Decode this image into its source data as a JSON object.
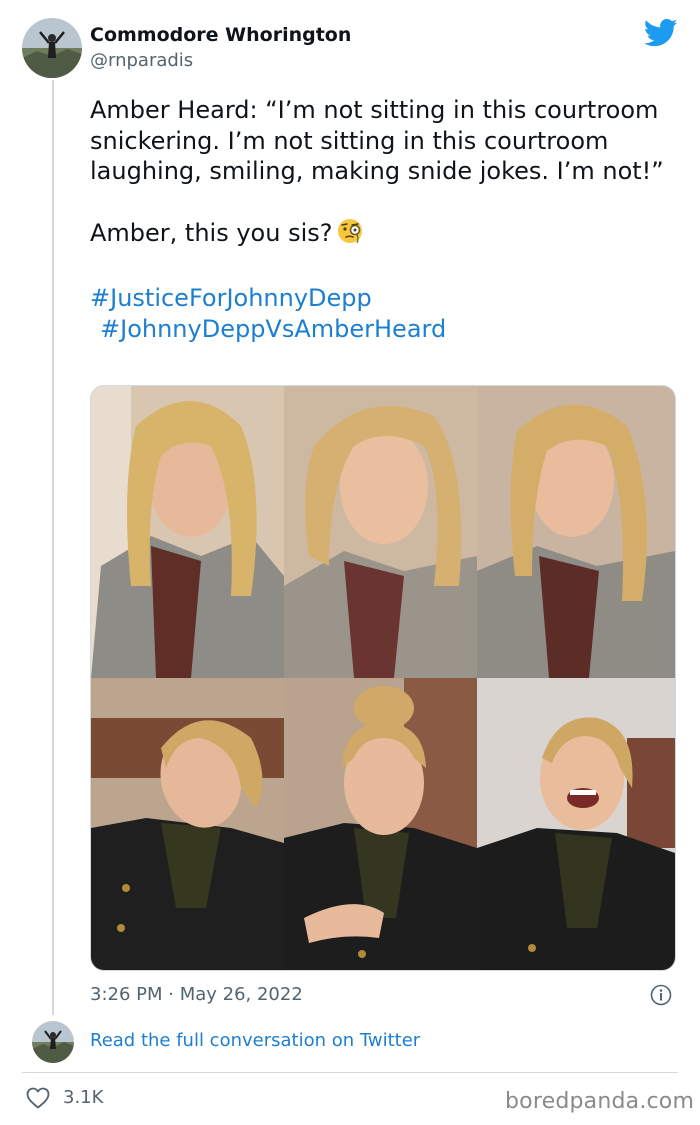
{
  "author": {
    "name": "Commodore Whorington",
    "handle": "@rnparadis"
  },
  "tweet": {
    "paragraph_1": "Amber Heard: “I’m not sitting in this courtroom snickering. I’m not sitting in this courtroom laughing, smiling, making snide jokes. I’m not!”",
    "paragraph_2": "Amber, this you sis?",
    "emoji": "face-with-monocle",
    "hashtags": [
      "#JusticeForJohnnyDepp",
      "#JohnnyDeppVsAmberHeard"
    ]
  },
  "media": {
    "photo_count": 6
  },
  "meta": {
    "timestamp": "3:26 PM · May 26, 2022"
  },
  "actions": {
    "read_conversation": "Read the full conversation on Twitter",
    "like_count": "3.1K"
  },
  "watermark": "boredpanda.com",
  "colors": {
    "link": "#1d7fd0",
    "twitter_blue": "#1d9bf0",
    "secondary_text": "#536471",
    "border": "#cfd9de"
  }
}
